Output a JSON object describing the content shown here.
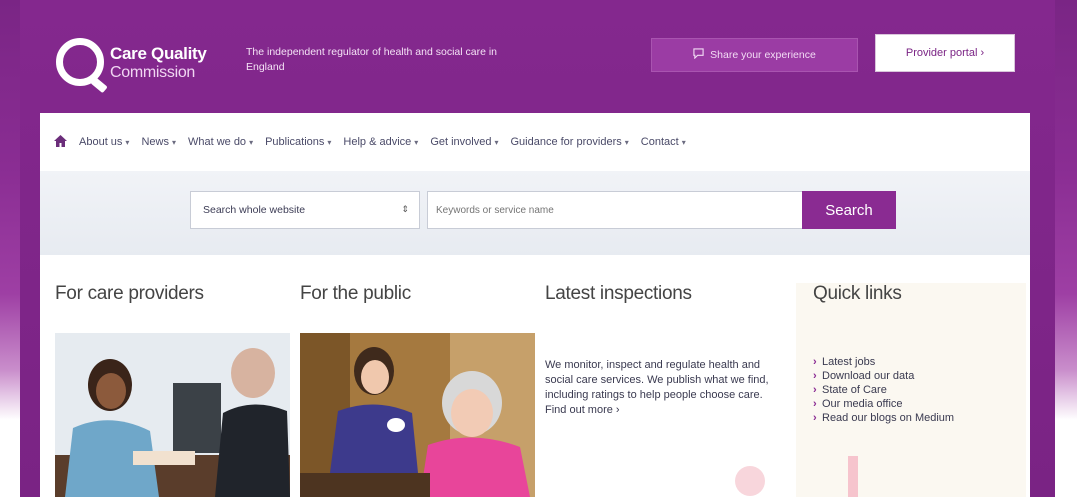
{
  "header": {
    "logo_line1": "Care Quality",
    "logo_line2": "Commission",
    "tagline": "The independent regulator of health and social care in England",
    "share_label": "Share your experience",
    "portal_label": "Provider portal ›"
  },
  "nav": {
    "items": [
      {
        "label": "About us"
      },
      {
        "label": "News"
      },
      {
        "label": "What we do"
      },
      {
        "label": "Publications"
      },
      {
        "label": "Help & advice"
      },
      {
        "label": "Get involved"
      },
      {
        "label": "Guidance for providers"
      },
      {
        "label": "Contact"
      }
    ]
  },
  "search": {
    "scope": "Search whole website",
    "placeholder": "Keywords or service name",
    "button_label": "Search"
  },
  "columns": {
    "providers_title": "For care providers",
    "public_title": "For the public",
    "inspections_title": "Latest inspections",
    "inspections_text": "We monitor, inspect and regulate health and social care services. We publish what we find, including ratings to help people choose care. Find out more ›",
    "quick_title": "Quick links",
    "quick_links": [
      {
        "label": "Latest jobs"
      },
      {
        "label": "Download our data"
      },
      {
        "label": "State of Care"
      },
      {
        "label": "Our media office"
      },
      {
        "label": "Read our blogs on Medium"
      }
    ]
  },
  "colors": {
    "brand_purple": "#7a2384",
    "button_purple": "#8a2b92"
  }
}
